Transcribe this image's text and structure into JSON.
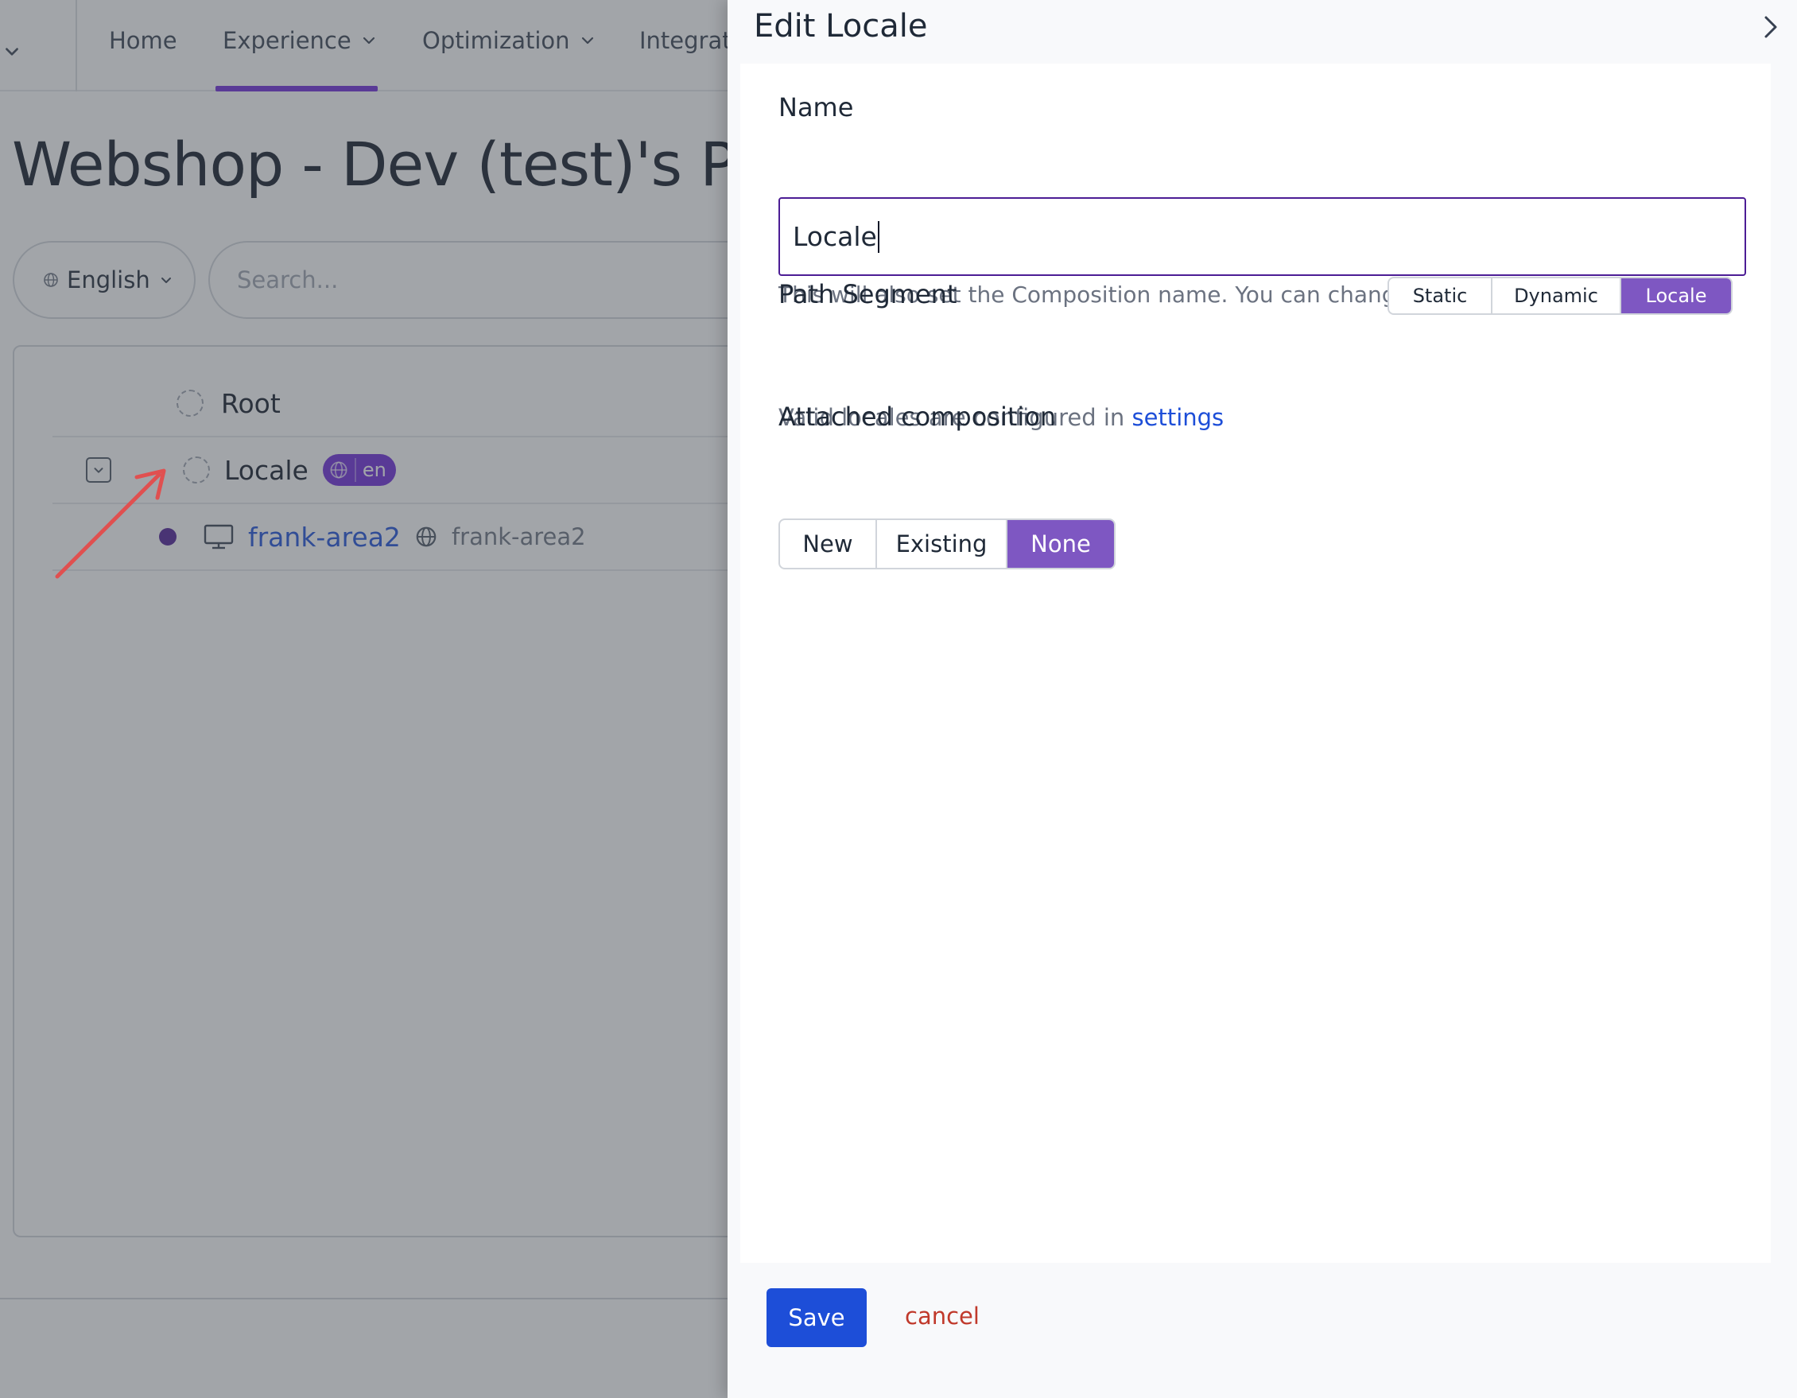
{
  "nav": {
    "items": [
      {
        "label": "Home"
      },
      {
        "label": "Experience"
      },
      {
        "label": "Optimization"
      },
      {
        "label": "Integrati"
      }
    ]
  },
  "page": {
    "title": "Webshop - Dev (test)'s Projec"
  },
  "filters": {
    "language": "English",
    "search_placeholder": "Search..."
  },
  "tree": {
    "root_label": "Root",
    "locale_label": "Locale",
    "locale_badge": "en",
    "child_label": "frank-area2",
    "child_path": "frank-area2"
  },
  "drawer": {
    "title": "Edit Locale",
    "name_label": "Name",
    "name_value": "Locale",
    "name_help": "This will also set the Composition name. You can change this later.",
    "path_segment_label": "Path Segment",
    "path_segment_options": [
      "Static",
      "Dynamic",
      "Locale"
    ],
    "path_segment_selected": "Locale",
    "valid_locales_text": "Valid locales are configured in",
    "valid_locales_link": "settings",
    "attached_label": "Attached composition",
    "attached_options": [
      "New",
      "Existing",
      "None"
    ],
    "attached_selected": "None",
    "save_label": "Save",
    "cancel_label": "cancel"
  },
  "colors": {
    "accent_purple": "#7e57c2",
    "primary_blue": "#1d4ed8",
    "danger_red": "#c0392b",
    "annotation_arrow": "#e05050"
  }
}
